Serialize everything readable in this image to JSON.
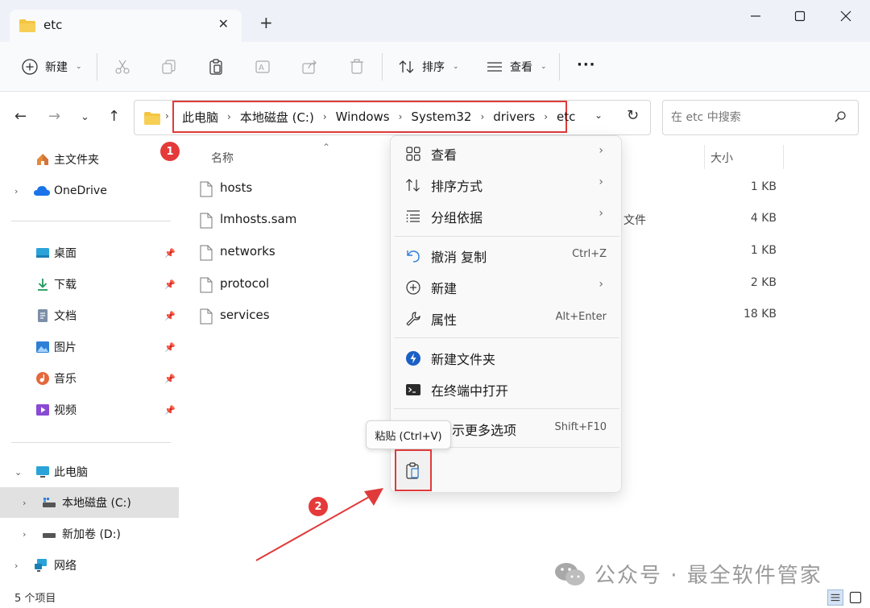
{
  "window": {
    "tab_title": "etc",
    "new_tab": "+"
  },
  "toolbar": {
    "new_label": "新建",
    "sort_label": "排序",
    "view_label": "查看",
    "more_label": "···"
  },
  "address": {
    "crumbs": [
      "此电脑",
      "本地磁盘 (C:)",
      "Windows",
      "System32",
      "drivers",
      "etc"
    ],
    "search_placeholder": "在 etc 中搜索"
  },
  "sidebar": {
    "items": [
      {
        "label": "主文件夹",
        "icon": "home-icon"
      },
      {
        "label": "OneDrive",
        "icon": "cloud-icon"
      },
      {
        "label": "桌面",
        "icon": "desktop-icon"
      },
      {
        "label": "下载",
        "icon": "download-icon"
      },
      {
        "label": "文档",
        "icon": "document-icon"
      },
      {
        "label": "图片",
        "icon": "picture-icon"
      },
      {
        "label": "音乐",
        "icon": "music-icon"
      },
      {
        "label": "视频",
        "icon": "video-icon"
      },
      {
        "label": "此电脑",
        "icon": "computer-icon"
      },
      {
        "label": "本地磁盘 (C:)",
        "icon": "drive-icon"
      },
      {
        "label": "新加卷 (D:)",
        "icon": "drive-icon"
      },
      {
        "label": "网络",
        "icon": "network-icon"
      }
    ]
  },
  "filelist": {
    "col_name": "名称",
    "col_size": "大小",
    "files": [
      {
        "name": "hosts",
        "type": "",
        "size": "1 KB"
      },
      {
        "name": "lmhosts.sam",
        "type": "文件",
        "size": "4 KB"
      },
      {
        "name": "networks",
        "type": "",
        "size": "1 KB"
      },
      {
        "name": "protocol",
        "type": "",
        "size": "2 KB"
      },
      {
        "name": "services",
        "type": "",
        "size": "18 KB"
      }
    ]
  },
  "context_menu": {
    "items": [
      {
        "label": "查看",
        "key": "",
        "submenu": true
      },
      {
        "label": "排序方式",
        "key": "",
        "submenu": true
      },
      {
        "label": "分组依据",
        "key": "",
        "submenu": true
      },
      {
        "label": "撤消 复制",
        "key": "Ctrl+Z",
        "submenu": false
      },
      {
        "label": "新建",
        "key": "",
        "submenu": true
      },
      {
        "label": "属性",
        "key": "Alt+Enter",
        "submenu": false
      },
      {
        "label": "新建文件夹",
        "key": "",
        "submenu": false
      },
      {
        "label": "在终端中打开",
        "key": "",
        "submenu": false
      },
      {
        "label": "示更多选项",
        "key": "Shift+F10",
        "submenu": false
      }
    ],
    "arrow": "›"
  },
  "tooltip": {
    "text": "粘贴 (Ctrl+V)"
  },
  "annotations": {
    "badge1": "1",
    "badge2": "2"
  },
  "status": {
    "count": "5 个项目"
  },
  "watermark": {
    "text": "公众号 · 最全软件管家"
  },
  "colors": {
    "accent_red": "#e03a3a",
    "folder_yellow": "#f4c542",
    "onedrive_blue": "#1a73e8"
  }
}
